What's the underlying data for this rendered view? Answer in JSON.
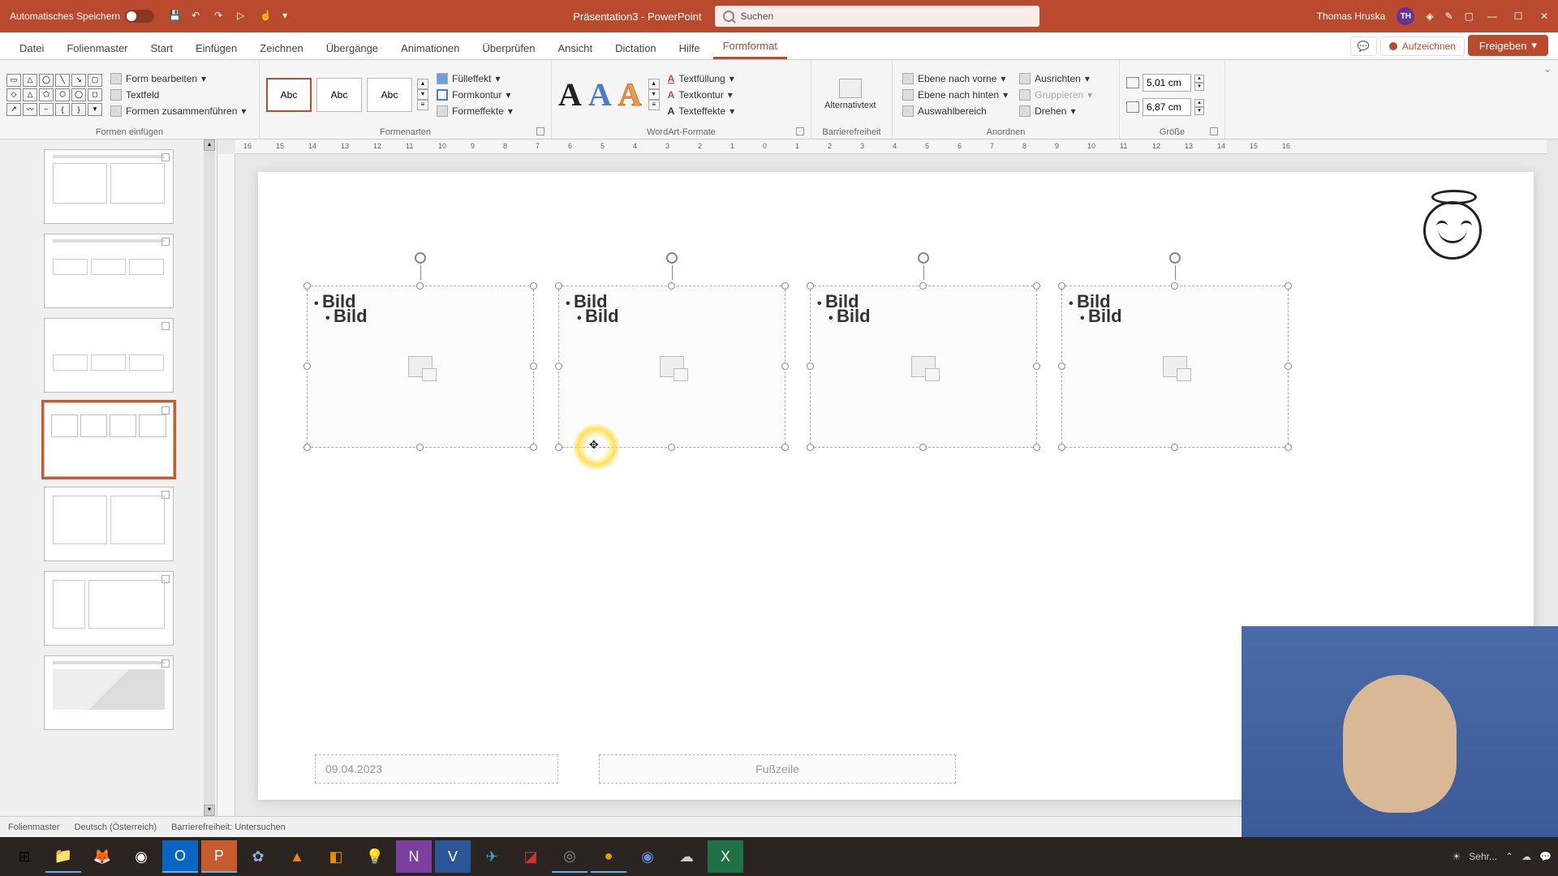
{
  "titlebar": {
    "autosave": "Automatisches Speichern",
    "doc": "Präsentation3 - PowerPoint",
    "search_placeholder": "Suchen",
    "user": "Thomas Hruska",
    "initials": "TH"
  },
  "tabs": {
    "file": "Datei",
    "master": "Folienmaster",
    "start": "Start",
    "insert": "Einfügen",
    "draw": "Zeichnen",
    "trans": "Übergänge",
    "anim": "Animationen",
    "review": "Überprüfen",
    "view": "Ansicht",
    "dict": "Dictation",
    "help": "Hilfe",
    "format": "Formformat",
    "record": "Aufzeichnen",
    "share": "Freigeben"
  },
  "ribbon": {
    "g1": "Formen einfügen",
    "g1_edit": "Form bearbeiten",
    "g1_text": "Textfeld",
    "g1_merge": "Formen zusammenführen",
    "g2": "Formenarten",
    "g2_abc": "Abc",
    "g2_fill": "Fülleffekt",
    "g2_outline": "Formkontur",
    "g2_effects": "Formeffekte",
    "g3": "WordArt-Formate",
    "g3_tfill": "Textfüllung",
    "g3_tout": "Textkontur",
    "g3_teff": "Texteffekte",
    "g4": "Barrierefreiheit",
    "g4_alt": "Alternativtext",
    "g5": "Anordnen",
    "g5_front": "Ebene nach vorne",
    "g5_back": "Ebene nach hinten",
    "g5_sel": "Auswahlbereich",
    "g5_align": "Ausrichten",
    "g5_group": "Gruppieren",
    "g5_rotate": "Drehen",
    "g6": "Größe",
    "g6_h": "5,01 cm",
    "g6_w": "6,87 cm"
  },
  "ruler": [
    "16",
    "15",
    "14",
    "13",
    "12",
    "11",
    "10",
    "9",
    "8",
    "7",
    "6",
    "5",
    "4",
    "3",
    "2",
    "1",
    "0",
    "1",
    "2",
    "3",
    "4",
    "5",
    "6",
    "7",
    "8",
    "9",
    "10",
    "11",
    "12",
    "13",
    "14",
    "15",
    "16"
  ],
  "slide": {
    "ph_label1": "Bild",
    "ph_label2": "Bild",
    "date": "09.04.2023",
    "footer": "Fußzeile"
  },
  "status": {
    "master": "Folienmaster",
    "lang": "Deutsch (Österreich)",
    "acc": "Barrierefreiheit: Untersuchen"
  },
  "tray": {
    "weather": "Sehr..."
  }
}
